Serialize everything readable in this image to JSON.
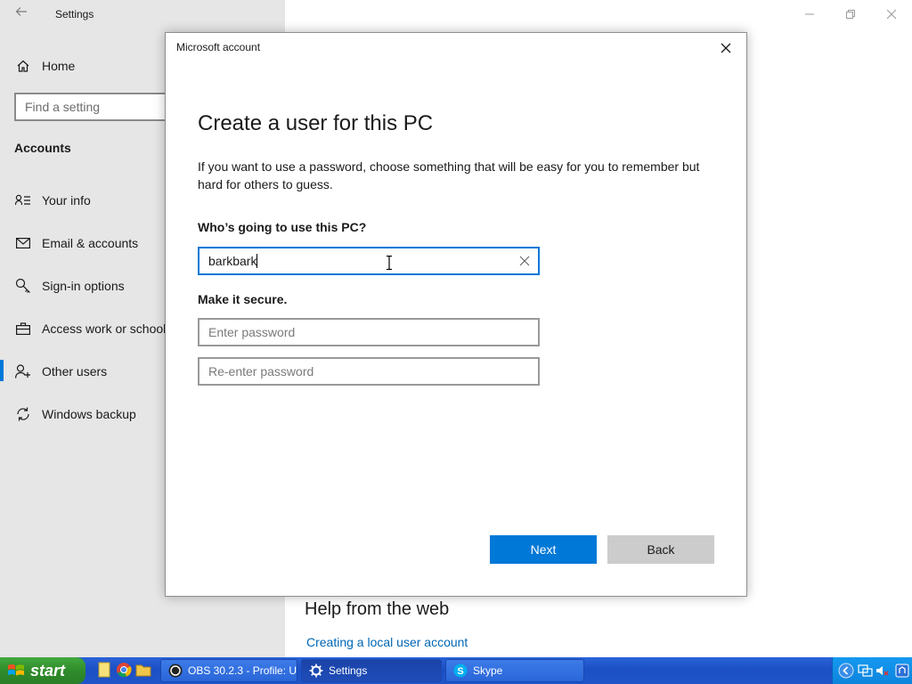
{
  "settings": {
    "title": "Settings",
    "home_label": "Home",
    "search_placeholder": "Find a setting",
    "section_title": "Accounts",
    "nav_items": [
      {
        "label": "Your info",
        "icon": "person-list-icon"
      },
      {
        "label": "Email & accounts",
        "icon": "mail-icon"
      },
      {
        "label": "Sign-in options",
        "icon": "key-icon"
      },
      {
        "label": "Access work or school",
        "icon": "briefcase-icon"
      },
      {
        "label": "Other users",
        "icon": "person-add-icon"
      },
      {
        "label": "Windows backup",
        "icon": "sync-icon"
      }
    ],
    "selected_item": "Other users",
    "help_title": "Help from the web",
    "help_link": "Creating a local user account"
  },
  "dialog": {
    "title": "Microsoft account",
    "heading": "Create a user for this PC",
    "description": "If you want to use a password, choose something that will be easy for you to remember but hard for others to guess.",
    "user_label": "Who’s going to use this PC?",
    "username_value": "barkbark",
    "secure_label": "Make it secure.",
    "password_placeholder": "Enter password",
    "reenter_placeholder": "Re-enter password",
    "next_label": "Next",
    "back_label": "Back"
  },
  "taskbar": {
    "start_label": "start",
    "tasks": [
      {
        "label": "OBS 30.2.3 - Profile: U...",
        "icon": "obs-icon"
      },
      {
        "label": "Settings",
        "icon": "gear-icon",
        "active": true
      },
      {
        "label": "Skype",
        "icon": "skype-icon"
      }
    ]
  },
  "colors": {
    "accent": "#0078d7",
    "sidebar_bg": "#e6e6e6",
    "link": "#0066b4"
  }
}
